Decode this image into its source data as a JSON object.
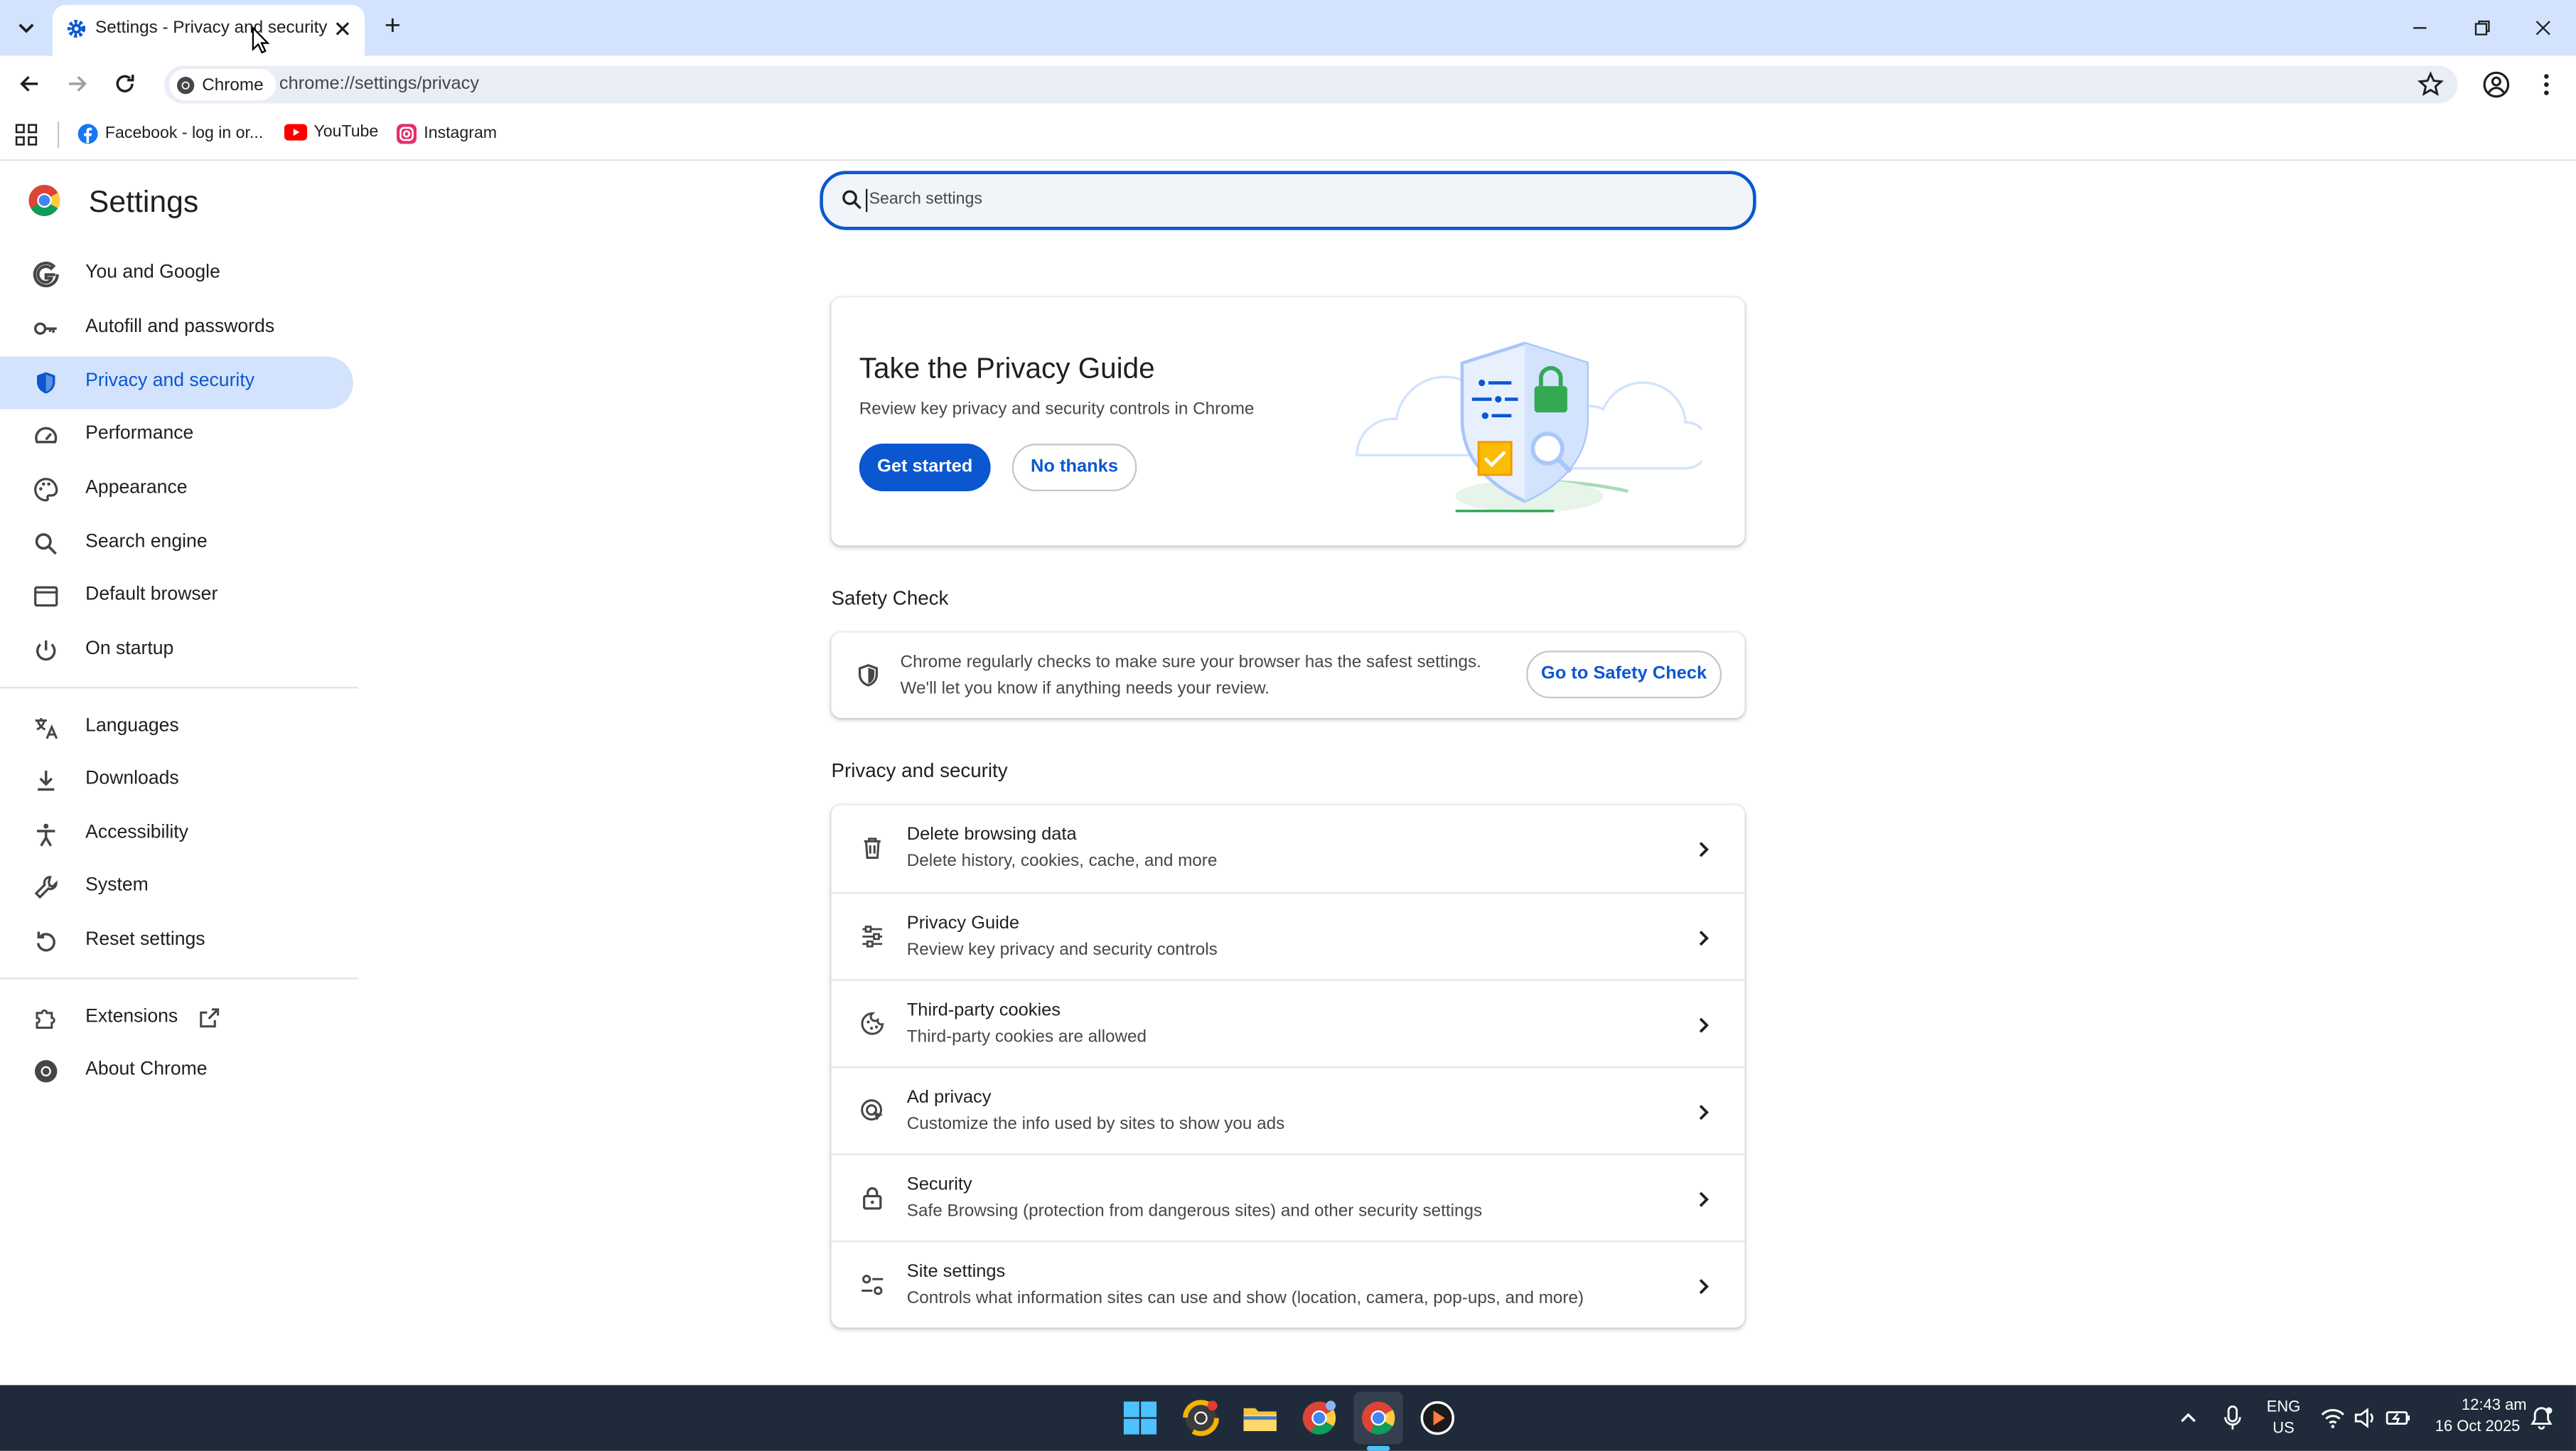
{
  "browser": {
    "tab_title": "Settings - Privacy and security",
    "new_tab_symbol": "+",
    "omnibox_chip": "Chrome",
    "url": "chrome://settings/privacy",
    "window_controls": [
      "minimize",
      "restore",
      "close"
    ]
  },
  "bookmarks": [
    {
      "label": "Facebook - log in or...",
      "icon": "facebook-icon",
      "color": "#1877f2"
    },
    {
      "label": "YouTube",
      "icon": "youtube-icon",
      "color": "#ff0000"
    },
    {
      "label": "Instagram",
      "icon": "instagram-icon",
      "color": "#e1306c"
    }
  ],
  "settings": {
    "title": "Settings",
    "search_placeholder": "Search settings",
    "nav": [
      {
        "label": "You and Google",
        "icon": "google-g-icon",
        "active": false
      },
      {
        "label": "Autofill and passwords",
        "icon": "key-icon",
        "active": false
      },
      {
        "label": "Privacy and security",
        "icon": "shield-icon",
        "active": true
      },
      {
        "label": "Performance",
        "icon": "speedometer-icon",
        "active": false
      },
      {
        "label": "Appearance",
        "icon": "palette-icon",
        "active": false
      },
      {
        "label": "Search engine",
        "icon": "search-icon",
        "active": false
      },
      {
        "label": "Default browser",
        "icon": "browser-window-icon",
        "active": false
      },
      {
        "label": "On startup",
        "icon": "power-icon",
        "active": false
      },
      {
        "label": "Languages",
        "icon": "translate-icon",
        "active": false
      },
      {
        "label": "Downloads",
        "icon": "download-icon",
        "active": false
      },
      {
        "label": "Accessibility",
        "icon": "accessibility-icon",
        "active": false
      },
      {
        "label": "System",
        "icon": "wrench-icon",
        "active": false
      },
      {
        "label": "Reset settings",
        "icon": "reset-icon",
        "active": false
      },
      {
        "label": "Extensions",
        "icon": "puzzle-icon",
        "active": false
      },
      {
        "label": "About Chrome",
        "icon": "chrome-icon",
        "active": false
      }
    ]
  },
  "privacy_guide": {
    "title": "Take the Privacy Guide",
    "subtitle": "Review key privacy and security controls in Chrome",
    "primary_button": "Get started",
    "secondary_button": "No thanks"
  },
  "safety_check": {
    "section_title": "Safety Check",
    "line1": "Chrome regularly checks to make sure your browser has the safest settings.",
    "line2": "We'll let you know if anything needs your review.",
    "button": "Go to Safety Check"
  },
  "privacy_security": {
    "section_title": "Privacy and security",
    "rows": [
      {
        "title": "Delete browsing data",
        "subtitle": "Delete history, cookies, cache, and more",
        "icon": "trash-icon"
      },
      {
        "title": "Privacy Guide",
        "subtitle": "Review key privacy and security controls",
        "icon": "sliders-icon"
      },
      {
        "title": "Third-party cookies",
        "subtitle": "Third-party cookies are allowed",
        "icon": "cookie-icon"
      },
      {
        "title": "Ad privacy",
        "subtitle": "Customize the info used by sites to show you ads",
        "icon": "ad-privacy-icon"
      },
      {
        "title": "Security",
        "subtitle": "Safe Browsing (protection from dangerous sites) and other security settings",
        "icon": "lock-icon"
      },
      {
        "title": "Site settings",
        "subtitle": "Controls what information sites can use and show (location, camera, pop-ups, and more)",
        "icon": "site-settings-icon"
      }
    ]
  },
  "taskbar": {
    "apps": [
      "windows-start-icon",
      "chrome-canary-icon",
      "file-explorer-icon",
      "chrome-icon",
      "chrome-icon",
      "media-player-icon"
    ],
    "lang_top": "ENG",
    "lang_bottom": "US",
    "time": "12:43 am",
    "date": "16 Oct 2025"
  },
  "colors": {
    "accent": "#0b57d0",
    "tabstrip": "#d3e3fd",
    "nav_active_bg": "#d3e3fd",
    "taskbar": "#1f2b3a"
  }
}
